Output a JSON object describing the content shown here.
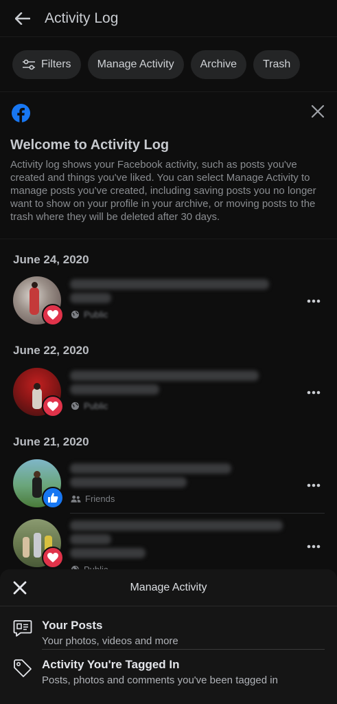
{
  "header": {
    "title": "Activity Log"
  },
  "chips": [
    {
      "label": "Filters",
      "icon": "sliders-icon"
    },
    {
      "label": "Manage Activity"
    },
    {
      "label": "Archive"
    },
    {
      "label": "Trash"
    }
  ],
  "welcome": {
    "title": "Welcome to Activity Log",
    "text": "Activity log shows your Facebook activity, such as posts you've created and things you've liked. You can select Manage Activity to manage posts you've created, including saving posts you no longer want to show on your profile in your archive, or moving posts to the trash where they will be deleted after 30 days."
  },
  "feed": [
    {
      "date": "June 24, 2020",
      "reaction": "love",
      "privacy": "Public"
    },
    {
      "date": "June 22, 2020",
      "reaction": "love",
      "privacy": "Public"
    },
    {
      "date": "June 21, 2020",
      "reaction": "like",
      "privacy": "Friends"
    },
    {
      "date": "",
      "reaction": "love",
      "privacy": "Public"
    }
  ],
  "sheet": {
    "title": "Manage Activity",
    "items": [
      {
        "title": "Your Posts",
        "subtitle": "Your photos, videos and more",
        "icon": "posts-icon"
      },
      {
        "title": "Activity You're Tagged In",
        "subtitle": "Posts, photos and comments you've been tagged in",
        "icon": "tag-icon"
      }
    ]
  },
  "colors": {
    "background": "#0e0e0e",
    "chip": "#242526",
    "love": "#e0334a",
    "like": "#1877f2",
    "facebook_blue": "#1877f2"
  }
}
